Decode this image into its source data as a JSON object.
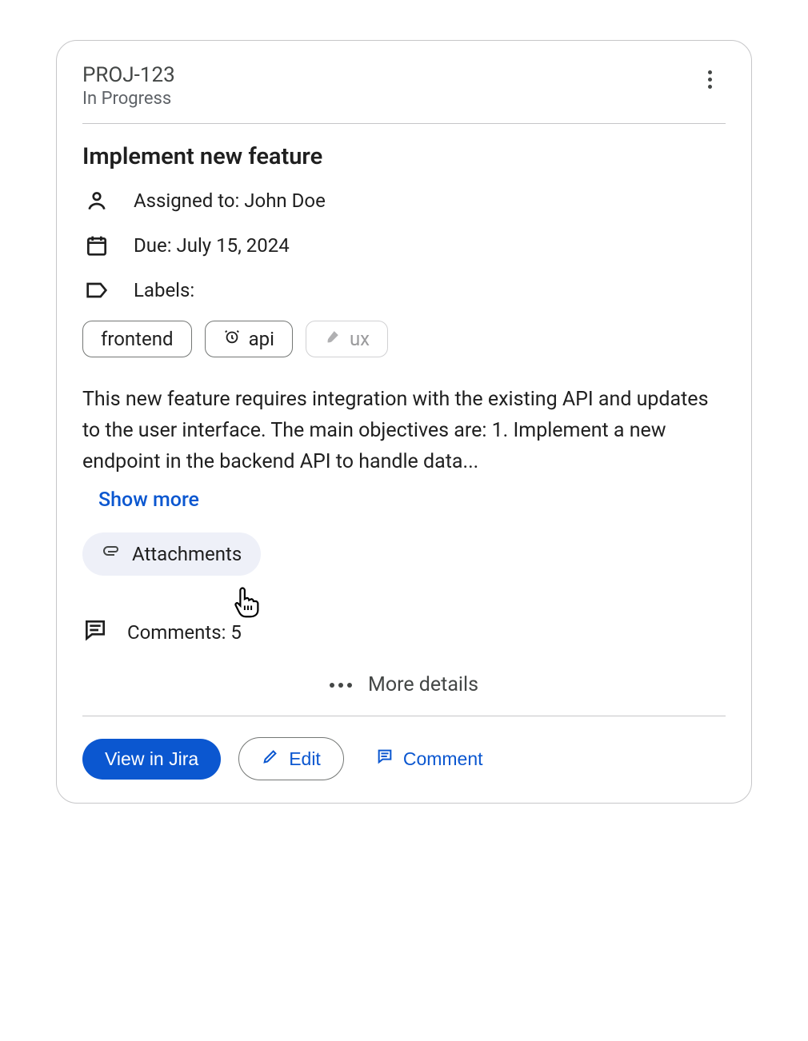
{
  "ticket": {
    "id": "PROJ-123",
    "status": "In Progress",
    "title": "Implement new feature",
    "assignee_line": "Assigned to: John Doe",
    "due_line": "Due: July 15, 2024",
    "labels_heading": "Labels:",
    "labels": [
      {
        "text": "frontend",
        "icon": null,
        "disabled": false
      },
      {
        "text": "api",
        "icon": "alarm",
        "disabled": false
      },
      {
        "text": "ux",
        "icon": "brush",
        "disabled": true
      }
    ],
    "description": "This new feature requires integration with the existing API and updates to the user interface. The main objectives are: 1. Implement a new endpoint in the backend API to handle data...",
    "show_more_label": "Show more",
    "attachments_label": "Attachments",
    "comments_line": "Comments: 5",
    "more_details_label": "More details"
  },
  "buttons": {
    "view_in_jira": "View in Jira",
    "edit": "Edit",
    "comment": "Comment"
  }
}
